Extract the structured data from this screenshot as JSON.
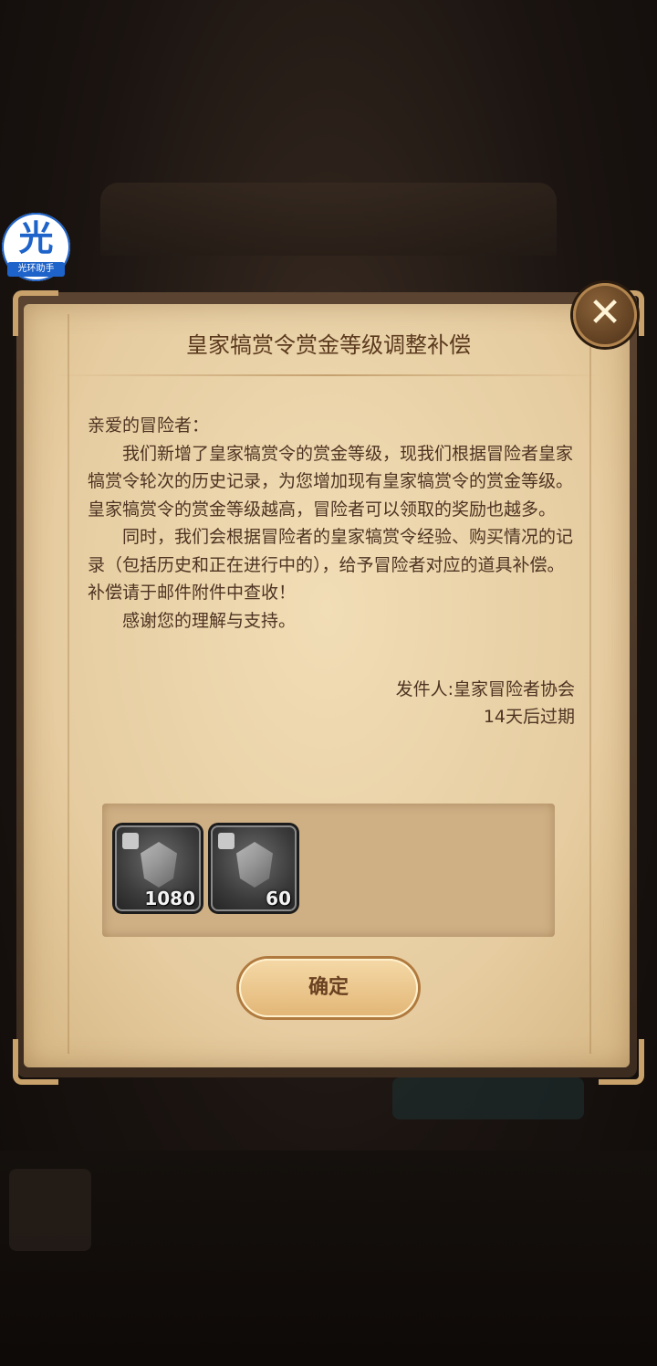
{
  "badge": {
    "char": "光",
    "label": "光环助手"
  },
  "dialog": {
    "title": "皇家犒赏令赏金等级调整补偿",
    "close_icon": "close-icon",
    "greeting": "亲爱的冒险者：",
    "paragraphs": [
      "我们新增了皇家犒赏令的赏金等级，现我们根据冒险者皇家犒赏令轮次的历史记录，为您增加现有皇家犒赏令的赏金等级。皇家犒赏令的赏金等级越高，冒险者可以领取的奖励也越多。",
      "同时，我们会根据冒险者的皇家犒赏令经验、购买情况的记录（包括历史和正在进行中的），给予冒险者对应的道具补偿。补偿请于邮件附件中查收！",
      "感谢您的理解与支持。"
    ],
    "sender": "发件人:皇家冒险者协会",
    "expiry": "14天后过期",
    "attachments": [
      {
        "icon": "puzzle-shard-icon",
        "count": "1080"
      },
      {
        "icon": "puzzle-shard-icon",
        "count": "60"
      }
    ],
    "confirm_label": "确定"
  }
}
